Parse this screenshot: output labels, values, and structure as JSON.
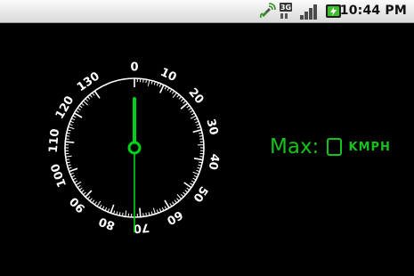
{
  "status_bar": {
    "time": "10:44 PM",
    "network_type": "3G",
    "icons": [
      "gps-satellite-icon",
      "network-3g-icon",
      "signal-strength-icon",
      "battery-charging-icon"
    ]
  },
  "speedometer": {
    "tick_labels": [
      "0",
      "10",
      "20",
      "30",
      "40",
      "50",
      "60",
      "70",
      "80",
      "90",
      "100",
      "110",
      "120",
      "130"
    ],
    "current_value": 0,
    "needle_color": "#00d21a"
  },
  "max_readout": {
    "label": "Max:",
    "value": "0",
    "unit": "KMPH",
    "color": "#15c21c"
  }
}
